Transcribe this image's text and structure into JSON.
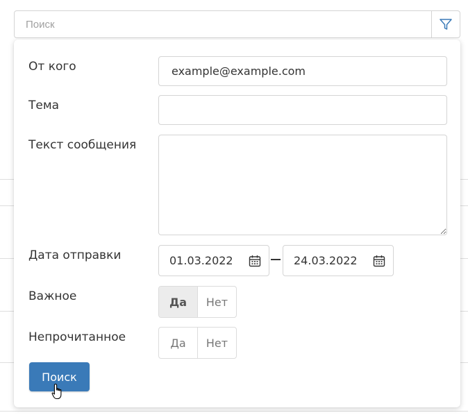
{
  "search": {
    "placeholder": "Поиск"
  },
  "filter": {
    "from_label": "От кого",
    "from_value": "example@example.com",
    "subject_label": "Тема",
    "subject_value": "",
    "body_label": "Текст сообщения",
    "body_value": "",
    "date_label": "Дата отправки",
    "date_from": "01.03.2022",
    "date_to": "24.03.2022",
    "important_label": "Важное",
    "important_options": [
      "Да",
      "Нет"
    ],
    "important_selected": "Да",
    "unread_label": "Непрочитанное",
    "unread_options": [
      "Да",
      "Нет"
    ],
    "unread_selected": "",
    "submit_label": "Поиск"
  },
  "colors": {
    "accent": "#3a7ab8",
    "filter_icon": "#3a7ab8",
    "border": "#d4d4d4"
  },
  "icons": [
    "filter-icon",
    "calendar-icon",
    "hand-cursor-icon"
  ]
}
